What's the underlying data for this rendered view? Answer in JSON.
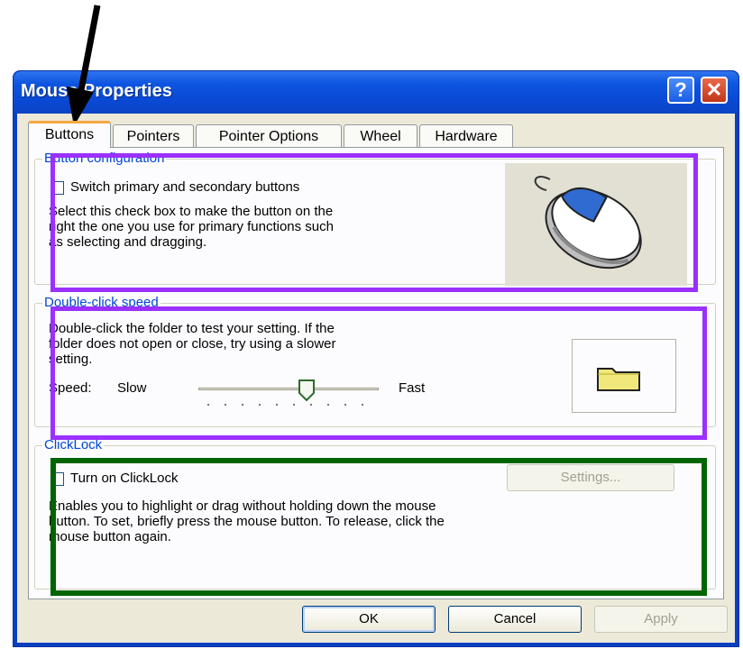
{
  "window": {
    "title": "Mouse Properties",
    "help_symbol": "?",
    "close_symbol": "✕"
  },
  "tabs": [
    {
      "label": "Buttons",
      "active": true
    },
    {
      "label": "Pointers",
      "active": false
    },
    {
      "label": "Pointer Options",
      "active": false
    },
    {
      "label": "Wheel",
      "active": false
    },
    {
      "label": "Hardware",
      "active": false
    }
  ],
  "button_configuration": {
    "title": "Button configuration",
    "checkbox_label": "Switch primary and secondary buttons",
    "checked": false,
    "description_lines": [
      "Select this check box to make the button on the",
      "right the one you use for primary functions such",
      "as selecting and dragging."
    ],
    "image_icon": "mouse-illustration"
  },
  "double_click_speed": {
    "title": "Double-click speed",
    "description_lines": [
      "Double-click the folder to test your setting. If the",
      "folder does not open or close, try using a slower",
      "setting."
    ],
    "speed_label": "Speed:",
    "slow_label": "Slow",
    "fast_label": "Fast",
    "slider_position": 0.6,
    "folder_icon": "folder-icon"
  },
  "clicklock": {
    "title": "ClickLock",
    "checkbox_label": "Turn on ClickLock",
    "checked": false,
    "settings_button": "Settings...",
    "description_lines": [
      "Enables you to highlight or drag without holding down the mouse",
      "button. To set, briefly press the mouse button. To release, click the",
      "mouse button again."
    ]
  },
  "buttons": {
    "ok": "OK",
    "cancel": "Cancel",
    "apply": "Apply"
  },
  "annotations": {
    "highlight_colors": {
      "button_configuration": "#9b30ff",
      "double_click_speed": "#9b30ff",
      "clicklock": "#006400"
    },
    "arrow_color": "#000000"
  }
}
